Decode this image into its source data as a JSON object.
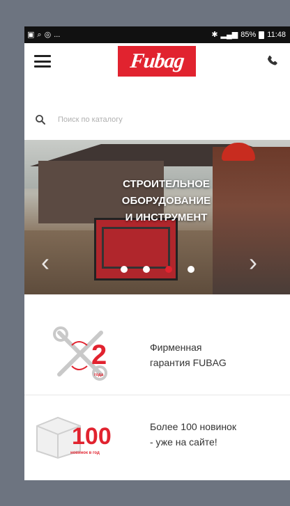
{
  "status_bar": {
    "signal_text": "85%",
    "time": "11:48",
    "left_overflow": "..."
  },
  "header": {
    "logo_text": "Fubag"
  },
  "search": {
    "placeholder": "Поиск по каталогу"
  },
  "banner": {
    "lines": [
      "СТРОИТЕЛЬНОЕ",
      "ОБОРУДОВАНИЕ",
      "И ИНСТРУМЕНТ"
    ],
    "slide_count": 4,
    "active_slide": 3
  },
  "features": [
    {
      "number": "2",
      "number_caption": "года",
      "text_line1": "Фирменная",
      "text_line2": "гарантия FUBAG"
    },
    {
      "number": "100",
      "number_caption": "новинок в год",
      "text_line1": "Более 100 новинок",
      "text_line2": "- уже на сайте!"
    }
  ],
  "colors": {
    "accent": "#e1232f",
    "frame": "#6d7480"
  }
}
